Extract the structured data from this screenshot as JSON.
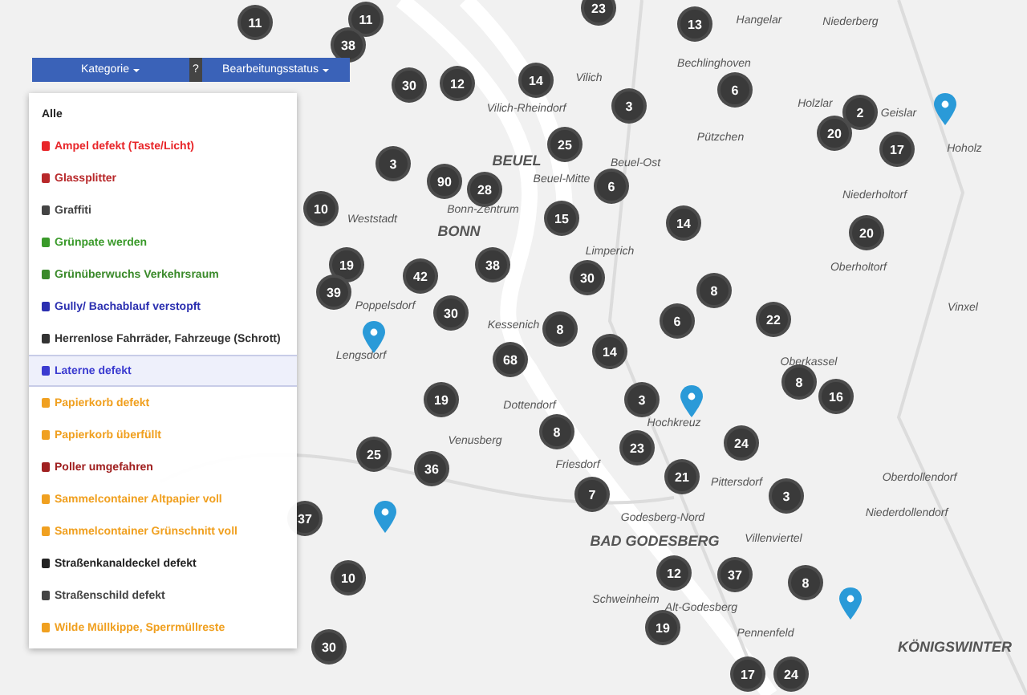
{
  "toolbar": {
    "category_button": "Kategorie",
    "help": "?",
    "status_button": "Bearbeitungsstatus"
  },
  "category_menu": [
    {
      "label": "Alle",
      "color": "#222222",
      "selected": false
    },
    {
      "label": "Ampel defekt (Taste/Licht)",
      "color": "#e8262a",
      "selected": false
    },
    {
      "label": "Glassplitter",
      "color": "#b8282a",
      "selected": false
    },
    {
      "label": "Graffiti",
      "color": "#444444",
      "selected": false
    },
    {
      "label": "Grünpate werden",
      "color": "#3a9a2a",
      "selected": false
    },
    {
      "label": "Grünüberwuchs Verkehrsraum",
      "color": "#3a8a2a",
      "selected": false
    },
    {
      "label": "Gully/ Bachablauf verstopft",
      "color": "#2b2fb0",
      "selected": false
    },
    {
      "label": "Herrenlose Fahrräder, Fahrzeuge (Schrott)",
      "color": "#333333",
      "selected": false
    },
    {
      "label": "Laterne defekt",
      "color": "#3b3bd0",
      "selected": true
    },
    {
      "label": "Papierkorb defekt",
      "color": "#f0a020",
      "selected": false
    },
    {
      "label": "Papierkorb überfüllt",
      "color": "#f0a020",
      "selected": false
    },
    {
      "label": "Poller umgefahren",
      "color": "#a02020",
      "selected": false
    },
    {
      "label": "Sammelcontainer Altpapier voll",
      "color": "#f0a020",
      "selected": false
    },
    {
      "label": "Sammelcontainer Grünschnitt voll",
      "color": "#f0a020",
      "selected": false
    },
    {
      "label": "Straßenkanaldeckel defekt",
      "color": "#222222",
      "selected": false
    },
    {
      "label": "Straßenschild defekt",
      "color": "#444444",
      "selected": false
    },
    {
      "label": "Wilde Müllkippe, Sperrmüllreste",
      "color": "#f0a020",
      "selected": false
    }
  ],
  "map": {
    "places": [
      "Hangelar",
      "Niederberg",
      "Vilich",
      "Vilich-Rheindorf",
      "Bechlinghoven",
      "Holzlar",
      "Hoholz",
      "Geislar",
      "Pützchen",
      "BEUEL",
      "Beuel-Ost",
      "Beuel-Mitte",
      "Bonn-Zentrum",
      "BONN",
      "Weststadt",
      "Poppelsdorf",
      "Limperich",
      "Niederholtorf",
      "Oberholtorf",
      "Vinxel",
      "Lengsdorf",
      "Kessenich",
      "Dottendorf",
      "Venusberg",
      "Hochkreuz",
      "Friesdorf",
      "Pittersdorf",
      "Oberkassel",
      "Oberdollendorf",
      "Niederdollendorf",
      "Godesberg-Nord",
      "Villenviertel",
      "BAD GODESBERG",
      "Schweinheim",
      "Alt-Godesberg",
      "Pennenfeld",
      "KÖNIGSWINTER"
    ],
    "clusters": [
      "11",
      "11",
      "38",
      "23",
      "13",
      "30",
      "12",
      "14",
      "3",
      "6",
      "2",
      "20",
      "17",
      "3",
      "90",
      "28",
      "25",
      "6",
      "15",
      "14",
      "20",
      "10",
      "19",
      "39",
      "42",
      "38",
      "30",
      "30",
      "8",
      "6",
      "22",
      "8",
      "14",
      "68",
      "19",
      "3",
      "8",
      "24",
      "23",
      "21",
      "36",
      "25",
      "7",
      "3",
      "37",
      "10",
      "12",
      "37",
      "8",
      "19",
      "17",
      "24",
      "30",
      "8",
      "16"
    ]
  }
}
